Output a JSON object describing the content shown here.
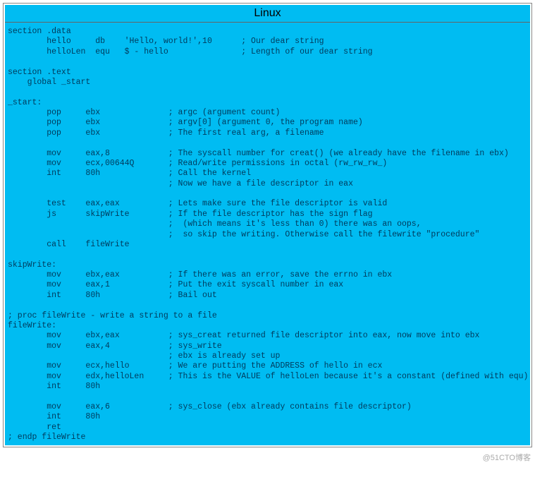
{
  "header": {
    "title": "Linux"
  },
  "code": {
    "lines": [
      "section .data",
      "        hello     db    'Hello, world!',10      ; Our dear string",
      "        helloLen  equ   $ - hello               ; Length of our dear string",
      "",
      "section .text",
      "    global _start",
      "",
      "_start:",
      "        pop     ebx              ; argc (argument count)",
      "        pop     ebx              ; argv[0] (argument 0, the program name)",
      "        pop     ebx              ; The first real arg, a filename",
      "",
      "        mov     eax,8            ; The syscall number for creat() (we already have the filename in ebx)",
      "        mov     ecx,00644Q       ; Read/write permissions in octal (rw_rw_rw_)",
      "        int     80h              ; Call the kernel",
      "                                 ; Now we have a file descriptor in eax",
      "",
      "        test    eax,eax          ; Lets make sure the file descriptor is valid",
      "        js      skipWrite        ; If the file descriptor has the sign flag",
      "                                 ;  (which means it's less than 0) there was an oops,",
      "                                 ;  so skip the writing. Otherwise call the filewrite \"procedure\"",
      "        call    fileWrite",
      "",
      "skipWrite:",
      "        mov     ebx,eax          ; If there was an error, save the errno in ebx",
      "        mov     eax,1            ; Put the exit syscall number in eax",
      "        int     80h              ; Bail out",
      "",
      "; proc fileWrite - write a string to a file",
      "fileWrite:",
      "        mov     ebx,eax          ; sys_creat returned file descriptor into eax, now move into ebx",
      "        mov     eax,4            ; sys_write",
      "                                 ; ebx is already set up",
      "        mov     ecx,hello        ; We are putting the ADDRESS of hello in ecx",
      "        mov     edx,helloLen     ; This is the VALUE of helloLen because it's a constant (defined with equ)",
      "        int     80h",
      "",
      "        mov     eax,6            ; sys_close (ebx already contains file descriptor)",
      "        int     80h",
      "        ret",
      "; endp fileWrite"
    ]
  },
  "footer": {
    "watermark": "@51CTO博客"
  }
}
